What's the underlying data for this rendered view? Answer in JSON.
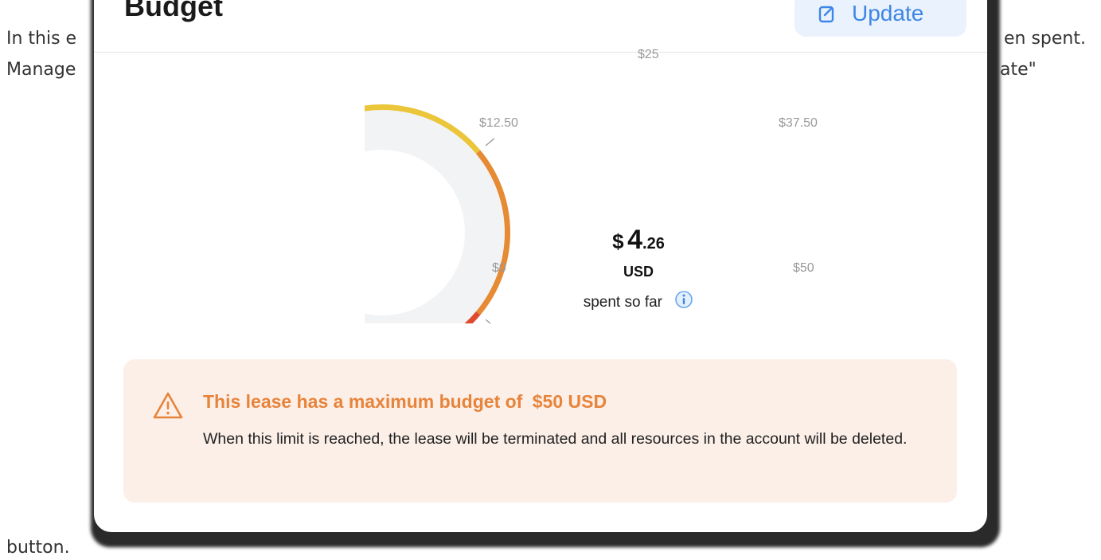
{
  "document": {
    "line1_start": "In this e",
    "line1_end": "en spent.",
    "line2_start": "Manage",
    "line2_end": "ate\"",
    "line3": "button."
  },
  "card": {
    "title": "Budget",
    "update_button": "Update"
  },
  "gauge": {
    "spent": 4.26,
    "max": 50,
    "ticks": [
      "$0",
      "$12.50",
      "$25",
      "$37.50",
      "$50"
    ],
    "amount_symbol": "$",
    "amount_whole": "4",
    "amount_cents": ".26",
    "currency": "USD",
    "caption": "spent so far",
    "colors": {
      "green": "#6fd14a",
      "yellow": "#ebc63a",
      "orange": "#e68a34",
      "red": "#de4a2f",
      "track": "#f2f3f4",
      "fill": "#7de154"
    }
  },
  "alert": {
    "title_prefix": "This lease has a maximum budget of",
    "title_amount": "$50 USD",
    "body": "When this limit is reached, the lease will be terminated and all resources in the account will be deleted.",
    "color": "#e8833a"
  }
}
